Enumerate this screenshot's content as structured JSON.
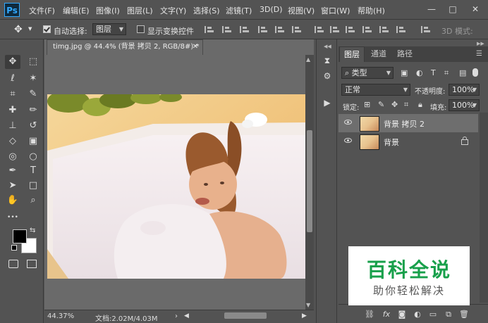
{
  "app": {
    "logo": "Ps",
    "menu": [
      "文件(F)",
      "编辑(E)",
      "图像(I)",
      "图层(L)",
      "文字(Y)",
      "选择(S)",
      "滤镜(T)",
      "3D(D)",
      "视图(V)",
      "窗口(W)",
      "帮助(H)"
    ],
    "window_controls": {
      "minimize": "—",
      "maximize": "□",
      "close": "✕"
    }
  },
  "options_bar": {
    "auto_select_label": "自动选择:",
    "auto_select_checked": true,
    "auto_select_value": "图层",
    "show_transform_label": "显示变换控件",
    "show_transform_checked": false,
    "mode_3d_label": "3D 模式:"
  },
  "tools": [
    {
      "name": "move-tool",
      "glyph": "✥",
      "active": true
    },
    {
      "name": "marquee-tool",
      "glyph": "⬚"
    },
    {
      "name": "lasso-tool",
      "glyph": "ℓ"
    },
    {
      "name": "magic-wand-tool",
      "glyph": "✶"
    },
    {
      "name": "crop-tool",
      "glyph": "⌗"
    },
    {
      "name": "eyedropper-tool",
      "glyph": "✎"
    },
    {
      "name": "healing-brush-tool",
      "glyph": "✚"
    },
    {
      "name": "brush-tool",
      "glyph": "✏"
    },
    {
      "name": "clone-stamp-tool",
      "glyph": "⊥"
    },
    {
      "name": "history-brush-tool",
      "glyph": "↺"
    },
    {
      "name": "eraser-tool",
      "glyph": "◇"
    },
    {
      "name": "gradient-tool",
      "glyph": "▣"
    },
    {
      "name": "blur-tool",
      "glyph": "◎"
    },
    {
      "name": "dodge-tool",
      "glyph": "○"
    },
    {
      "name": "pen-tool",
      "glyph": "✒"
    },
    {
      "name": "type-tool",
      "glyph": "T"
    },
    {
      "name": "path-selection-tool",
      "glyph": "➤"
    },
    {
      "name": "rectangle-tool",
      "glyph": "□"
    },
    {
      "name": "hand-tool",
      "glyph": "✋"
    },
    {
      "name": "zoom-tool",
      "glyph": "⌕"
    },
    {
      "name": "more-tools",
      "glyph": "•••"
    }
  ],
  "colors": {
    "foreground": "#000000",
    "background": "#ffffff"
  },
  "document": {
    "tab_title": "timg.jpg @ 44.4% (背景 拷贝 2, RGB/8#) *",
    "zoom": "44.37%",
    "doc_size": "文档:2.02M/4.03M"
  },
  "layers_panel": {
    "tabs": [
      "图层",
      "通道",
      "路径"
    ],
    "filter_kind": "类型",
    "blend_mode": "正常",
    "opacity_label": "不透明度:",
    "opacity_value": "100%",
    "lock_label": "锁定:",
    "fill_label": "填充:",
    "fill_value": "100%",
    "layers": [
      {
        "name": "背景 拷贝 2",
        "selected": true,
        "locked": false
      },
      {
        "name": "背景",
        "selected": false,
        "locked": true
      }
    ],
    "bottom_icons": [
      "link-icon",
      "fx-icon",
      "mask-icon",
      "adjustment-icon",
      "group-icon",
      "new-layer-icon",
      "trash-icon"
    ]
  },
  "watermark": {
    "title": "百科全说",
    "subtitle": "助你轻松解决"
  }
}
